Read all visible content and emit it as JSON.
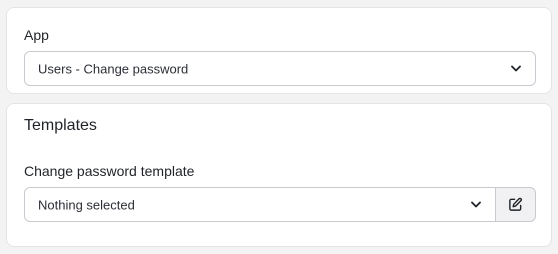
{
  "app_section": {
    "label": "App",
    "select_value": "Users - Change password",
    "chevron_icon": "chevron-down-icon"
  },
  "templates_section": {
    "title": "Templates",
    "field_label": "Change password template",
    "select_value": "Nothing selected",
    "chevron_icon": "chevron-down-icon",
    "edit_icon": "edit-icon"
  }
}
